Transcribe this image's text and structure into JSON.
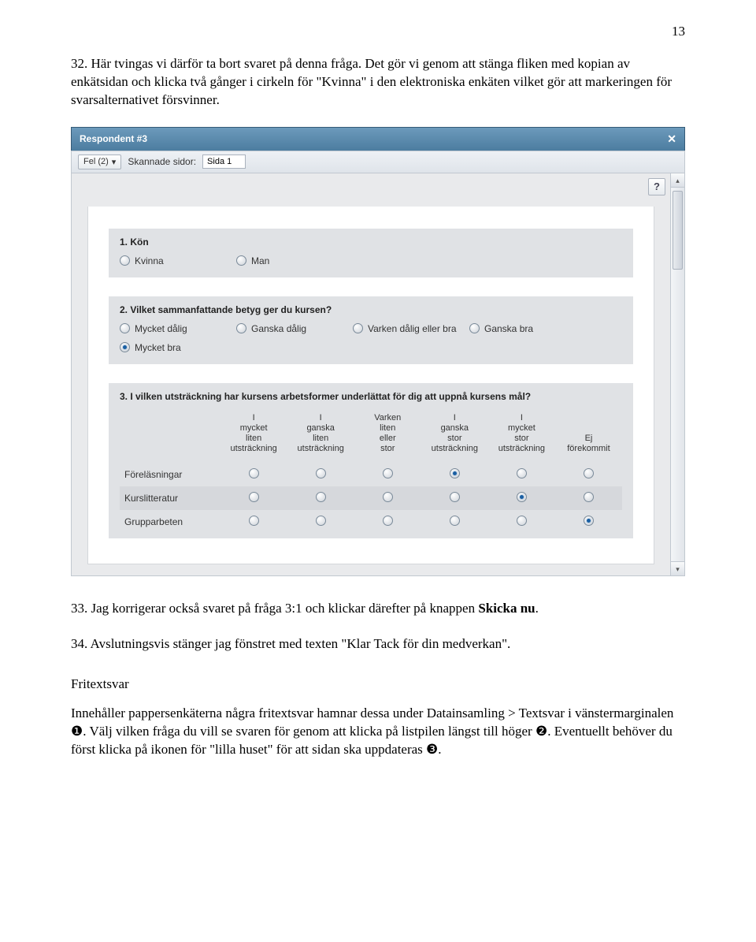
{
  "page_number": "13",
  "paras": {
    "p32": "32. Här tvingas vi därför ta bort svaret på denna fråga. Det gör vi genom att stänga fliken med kopian av enkätsidan och klicka två gånger i cirkeln för \"Kvinna\" i den elektroniska enkäten vilket gör att markeringen för svarsalternativet försvinner.",
    "p33_a": "33. Jag korrigerar också svaret på fråga 3:1 och klickar därefter på knappen ",
    "p33_b": "Skicka nu",
    "p33_c": ".",
    "p34": "34. Avslutningsvis stänger jag fönstret med texten \"Klar Tack för din medverkan\".",
    "heading": "Fritextsvar",
    "body_a": "Innehåller pappersenkäterna några fritextsvar hamnar dessa under Datainsamling > Textsvar i vänstermarginalen ",
    "body_b": ". Välj vilken fråga du vill se svaren för genom att klicka på listpilen längst till höger ",
    "body_c": ". Eventuellt behöver du först klicka på ikonen för \"lilla huset\" för att sidan ska uppdateras ",
    "body_d": ".",
    "circ1": "❶",
    "circ2": "❷",
    "circ3": "❸"
  },
  "shot": {
    "title": "Respondent #3",
    "toolbar": {
      "fel_label": "Fel (2)",
      "skannade_label": "Skannade sidor:",
      "sidor_value": "Sida 1"
    },
    "help": "?",
    "q1": {
      "title": "1. Kön",
      "opts": [
        "Kvinna",
        "Man"
      ]
    },
    "q2": {
      "title": "2. Vilket sammanfattande betyg ger du kursen?",
      "opts": [
        "Mycket dålig",
        "Ganska dålig",
        "Varken dålig eller bra",
        "Ganska bra",
        "Mycket bra"
      ],
      "checked_index": 4
    },
    "q3": {
      "title": "3. I vilken utsträckning har kursens arbetsformer underlättat för dig att uppnå kursens mål?",
      "cols": [
        "I mycket liten utsträckning",
        "I ganska liten utsträckning",
        "Varken liten eller stor",
        "I ganska stor utsträckning",
        "I mycket stor utsträckning",
        "Ej förekommit"
      ],
      "rows": [
        {
          "label": "Föreläsningar",
          "checked": 3
        },
        {
          "label": "Kurslitteratur",
          "checked": 4
        },
        {
          "label": "Grupparbeten",
          "checked": 5
        }
      ]
    }
  }
}
